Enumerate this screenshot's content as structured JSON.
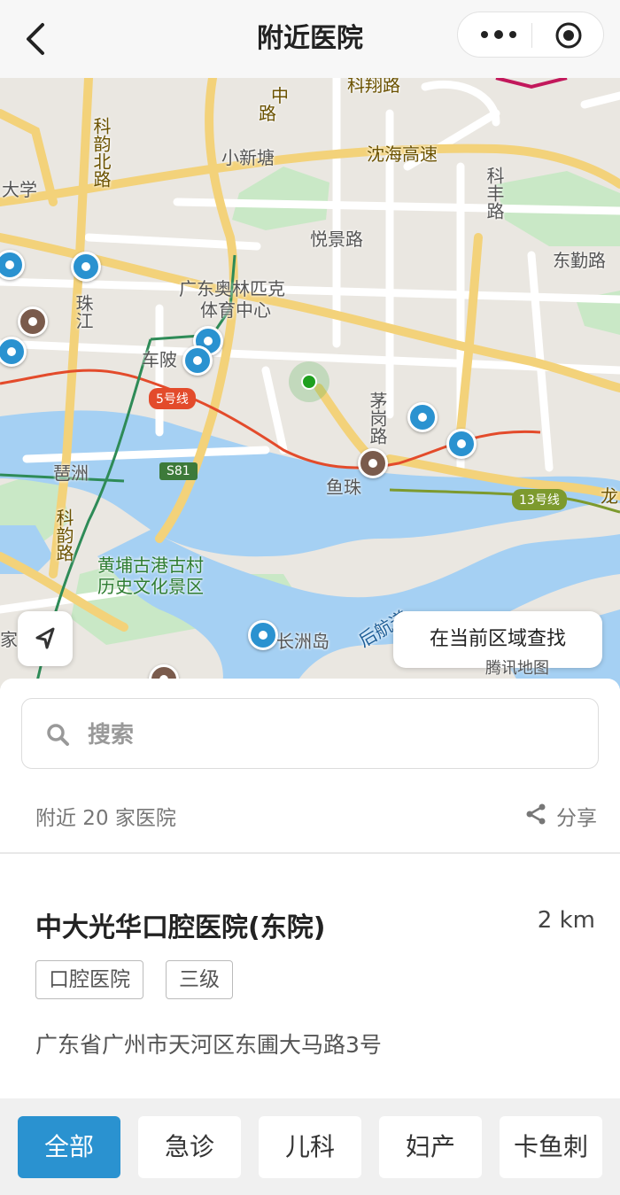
{
  "header": {
    "title": "附近医院"
  },
  "map": {
    "labels": {
      "kexiu": "科韵北路",
      "xiaoxintang": "小新塘",
      "shenhai": "沈海高速",
      "daxue": "大学",
      "yuejing": "悦景路",
      "kefeng": "科丰路",
      "dongqin": "东勤路",
      "olympic1": "广东奥林匹克",
      "olympic2": "体育中心",
      "zhujiang": "珠江",
      "chepi": "车陂",
      "maogang": "茅岗路",
      "yuzhu": "鱼珠",
      "pazhou": "琶洲",
      "keyun": "科韵路",
      "huangpu1": "黄埔古港古村",
      "huangpu2": "历史文化景区",
      "changzhou": "长洲岛",
      "houhang": "后航道",
      "long": "龙",
      "jia": "家",
      "zhong": "中",
      "lu": "路",
      "kexiang": "科翔路"
    },
    "line5": "5号线",
    "line13": "13号线",
    "s81": "S81",
    "search_area_label": "在当前区域查找",
    "logo": "腾讯地图"
  },
  "sheet": {
    "search_placeholder": "搜索",
    "count_text": "附近 20 家医院",
    "share_label": "分享"
  },
  "hospital": {
    "name": "中大光华口腔医院(东院)",
    "distance": "2 km",
    "tags": [
      "口腔医院",
      "三级"
    ],
    "address": "广东省广州市天河区东圃大马路3号"
  },
  "categories": [
    "全部",
    "急诊",
    "儿科",
    "妇产",
    "卡鱼刺"
  ],
  "colors": {
    "accent": "#2a92d0",
    "pin_brown": "#7a5b4c",
    "line5": "#e34b2b",
    "line13": "#7d9a2e",
    "river": "#a5d0f3",
    "park": "#c9e8c6"
  }
}
